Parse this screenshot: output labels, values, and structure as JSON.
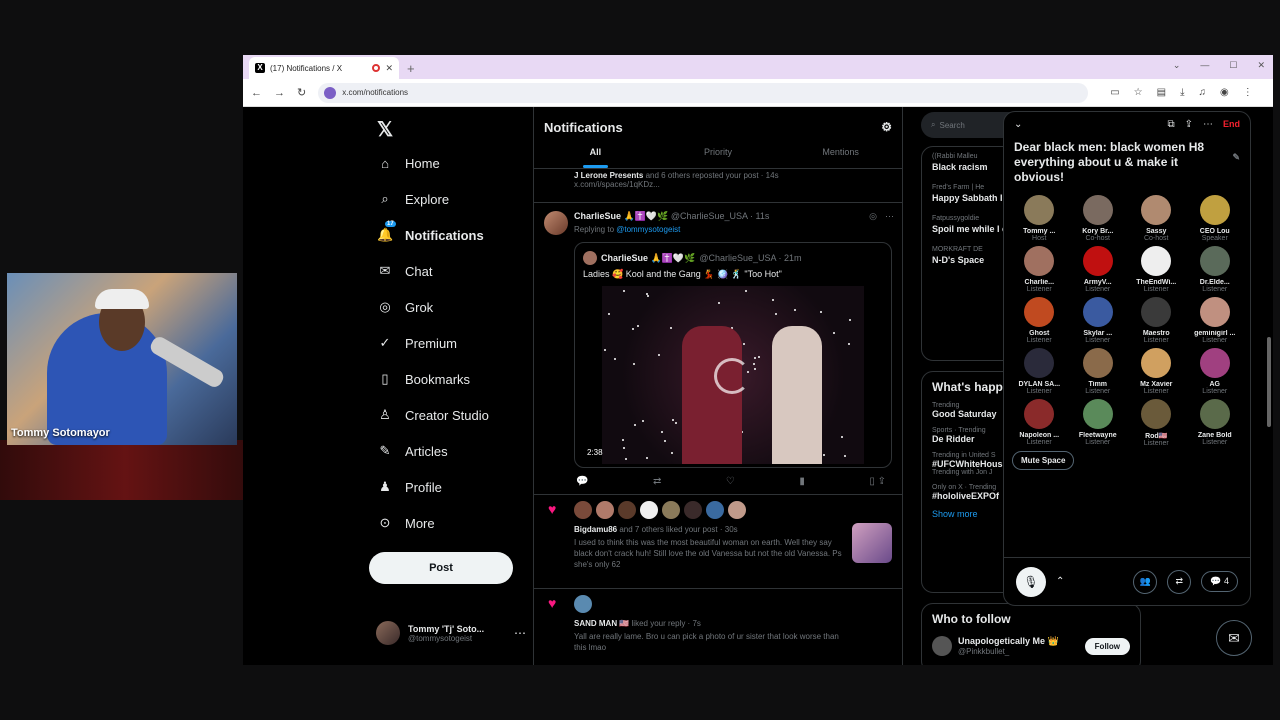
{
  "webcam": {
    "name": "Tommy Sotomayor"
  },
  "browser": {
    "tab_title": "(17) Notifications / X",
    "url": "x.com/notifications"
  },
  "nav": {
    "items": [
      {
        "label": "Home",
        "icon": "home-icon",
        "glyph": "⌂"
      },
      {
        "label": "Explore",
        "icon": "search-icon",
        "glyph": "⌕"
      },
      {
        "label": "Notifications",
        "icon": "bell-icon",
        "glyph": "🔔"
      },
      {
        "label": "Chat",
        "icon": "mail-icon",
        "glyph": "✉"
      },
      {
        "label": "Grok",
        "icon": "grok-icon",
        "glyph": "◎"
      },
      {
        "label": "Premium",
        "icon": "check-circle-icon",
        "glyph": "✓"
      },
      {
        "label": "Bookmarks",
        "icon": "bookmark-icon",
        "glyph": "▯"
      },
      {
        "label": "Creator Studio",
        "icon": "flask-icon",
        "glyph": "♙"
      },
      {
        "label": "Articles",
        "icon": "article-icon",
        "glyph": "✎"
      },
      {
        "label": "Profile",
        "icon": "person-icon",
        "glyph": "♟"
      },
      {
        "label": "More",
        "icon": "more-icon",
        "glyph": "⊙"
      }
    ],
    "notif_badge": "17",
    "post_label": "Post",
    "account_name": "Tommy 'Tj' Soto...",
    "account_handle": "@tommysotogeist"
  },
  "feed": {
    "title": "Notifications",
    "tabs": [
      "All",
      "Priority",
      "Mentions"
    ],
    "repost": {
      "who": "J Lerone Presents",
      "text": "and 6 others reposted your post · 14s",
      "link": "x.com/i/spaces/1qKDz..."
    },
    "tweet": {
      "name": "CharlieSue 🙏✝️🤍🌿",
      "meta": "@CharlieSue_USA · 11s",
      "replying_prefix": "Replying to",
      "replying_to": "@tommysotogeist",
      "quote_name": "CharlieSue 🙏✝️🤍🌿",
      "quote_meta": "@CharlieSue_USA · 21m",
      "quote_text": "Ladies 🥰 Kool and the Gang 💃 🪩 🕺 \"Too Hot\"",
      "duration": "2:38"
    },
    "likes": {
      "who": "Bigdamu86",
      "text": "and 7 others liked your post · 30s",
      "body": "I used to think this was the most beautiful woman on earth. Well they say black don't crack huh!  Still love the old Vanessa but not the old Vanessa.   Ps she's only 62"
    },
    "reply_like": {
      "who": "SAND MAN 🇺🇸",
      "text": "liked your reply · 7s",
      "body": "Yall are really lame.  Bro u can pick a photo of ur sister that look worse than this lmao"
    }
  },
  "right": {
    "search_placeholder": "Search",
    "spaces": [
      {
        "t": "((Rabbi Malleu",
        "b": "Black racism"
      },
      {
        "t": "Fred's Farm | He",
        "b": "Happy Sabbath I"
      },
      {
        "t": "Fatpussygoldie",
        "b": "Spoil me while I c kitchen $desireg"
      },
      {
        "t": "MORKRAFT DE",
        "b": "N-D's Space"
      }
    ],
    "happening_title": "What's happ",
    "trends": [
      {
        "c": "Trending",
        "n": "Good Saturday"
      },
      {
        "c": "Sports · Trending",
        "n": "De Ridder"
      },
      {
        "c": "Trending in United S",
        "n": "#UFCWhiteHous"
      },
      {
        "c": "Only on X · Trending",
        "n": "#hololiveEXPOf"
      }
    ],
    "trend_sub": "Trending with Jon J",
    "show_more": "Show more",
    "wtf_title": "Who to follow",
    "wtf_name": "Unapologetically Me 👑",
    "wtf_handle": "@Pinkkbullet_",
    "follow_label": "Follow"
  },
  "space": {
    "end_label": "End",
    "title": "Dear black men: black women H8 everything about u & make it obvious!",
    "participants": [
      {
        "name": "Tommy ...",
        "role": "Host",
        "color": "#8a7a5a"
      },
      {
        "name": "Kory Br...",
        "role": "Co-host",
        "color": "#7a6a60"
      },
      {
        "name": "Sassy",
        "role": "Co-host",
        "color": "#b08a70"
      },
      {
        "name": "CEO Lou",
        "role": "Speaker",
        "color": "#c0a040"
      },
      {
        "name": "Charlie...",
        "role": "Listener",
        "color": "#a07060"
      },
      {
        "name": "ArmyV...",
        "role": "Listener",
        "color": "#c01010"
      },
      {
        "name": "TheEndWi...",
        "role": "Listener",
        "color": "#eeeeee"
      },
      {
        "name": "Dr.Elde...",
        "role": "Listener",
        "color": "#5a6a5a"
      },
      {
        "name": "Ghost",
        "role": "Listener",
        "color": "#c04a20"
      },
      {
        "name": "Skylar ...",
        "role": "Listener",
        "color": "#3a5aa0"
      },
      {
        "name": "Maestro",
        "role": "Listener",
        "color": "#3a3a3a"
      },
      {
        "name": "geminigirl ...",
        "role": "Listener",
        "color": "#c09080"
      },
      {
        "name": "DYLAN SA...",
        "role": "Listener",
        "color": "#2a2a3a"
      },
      {
        "name": "Timm",
        "role": "Listener",
        "color": "#8a6a4a"
      },
      {
        "name": "Mz Xavier",
        "role": "Listener",
        "color": "#d0a060"
      },
      {
        "name": "AG",
        "role": "Listener",
        "color": "#a04080"
      },
      {
        "name": "Napoleon ...",
        "role": "Listener",
        "color": "#8a2a2a"
      },
      {
        "name": "Fleetwayne",
        "role": "Listener",
        "color": "#5a8a5a"
      },
      {
        "name": "Rod🇺🇸",
        "role": "Listener",
        "color": "#6a5a3a"
      },
      {
        "name": "Zane Bold",
        "role": "Listener",
        "color": "#5a6a4a"
      }
    ],
    "mute_label": "Mute Space",
    "comment_count": "4"
  }
}
